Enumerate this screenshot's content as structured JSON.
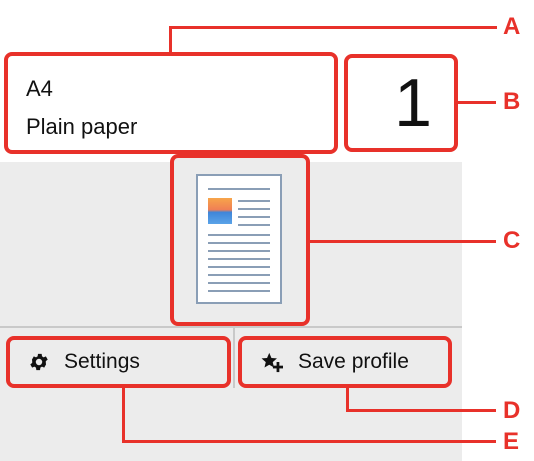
{
  "paper": {
    "size": "A4",
    "type": "Plain paper"
  },
  "copies": {
    "value": "1"
  },
  "buttons": {
    "settings_label": "Settings",
    "save_profile_label": "Save profile"
  },
  "callouts": {
    "a": "A",
    "b": "B",
    "c": "C",
    "d": "D",
    "e": "E"
  },
  "colors": {
    "accent": "#e8312a",
    "panel": "#ececec"
  },
  "icons": {
    "settings": "gear-icon",
    "save_profile": "star-plus-icon",
    "preview": "document-preview-icon"
  }
}
